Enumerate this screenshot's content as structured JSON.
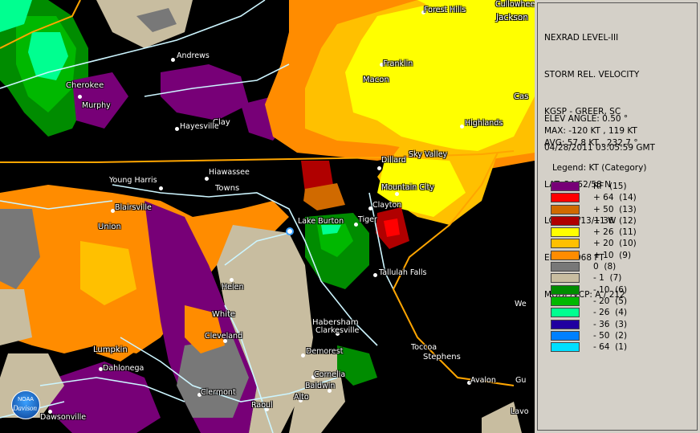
{
  "info": {
    "product": "NEXRAD LEVEL-III",
    "type": "STORM REL. VELOCITY",
    "site": "KGSP - GREER, SC",
    "datetime": "04/28/2011 03:05:59 GMT",
    "lat": "LAT: 34/52/58 N",
    "lon": "LON: 82/13/11 W",
    "elev": "ELEV: 1068 FT",
    "mode": "MODE/VCP: A / 212"
  },
  "stats": {
    "angle": "ELEV ANGLE: 0.50 °",
    "max": "MAX: -120 KT , 119 KT",
    "avg": "AVG: 57.8 KT , 232.7 °"
  },
  "legend": {
    "title": "Legend: KT (Category)",
    "items": [
      {
        "label": "RF  (15)",
        "color": "#770077"
      },
      {
        "label": "+ 64  (14)",
        "color": "#ff0000"
      },
      {
        "label": "+ 50  (13)",
        "color": "#d06a00"
      },
      {
        "label": "+ 36  (12)",
        "color": "#b00000"
      },
      {
        "label": "+ 26  (11)",
        "color": "#ffff00"
      },
      {
        "label": "+ 20  (10)",
        "color": "#ffc000"
      },
      {
        "label": "+ 10  (9)",
        "color": "#ff8c00"
      },
      {
        "label": "0  (8)",
        "color": "#787878"
      },
      {
        "label": "- 1  (7)",
        "color": "#c8bda0"
      },
      {
        "label": "- 10  (6)",
        "color": "#008c00"
      },
      {
        "label": "- 20  (5)",
        "color": "#00b800"
      },
      {
        "label": "- 26  (4)",
        "color": "#00ff90"
      },
      {
        "label": "- 36  (3)",
        "color": "#2000a0"
      },
      {
        "label": "- 50  (2)",
        "color": "#0080ff"
      },
      {
        "label": "- 64  (1)",
        "color": "#00e0ff"
      }
    ]
  },
  "map": {
    "labels": {
      "forest_hills": "Forest Hills",
      "cullowhee": "Cullowhee",
      "jackson": "Jackson",
      "andrews": "Andrews",
      "franklin": "Franklin",
      "cherokee": "Cherokee",
      "macon": "Macon",
      "cas": "Cas",
      "murphy": "Murphy",
      "clay": "Clay",
      "hayesville": "Hayesville",
      "highlands": "Highlands",
      "dillard": "Dillard",
      "sky_valley": "Sky Valley",
      "hiawassee": "Hiawassee",
      "young_harris": "Young Harris",
      "towns": "Towns",
      "mountain_city": "Mountain City",
      "clayton": "Clayton",
      "blairsville": "Blairsville",
      "lake_burton": "Lake Burton",
      "tiger": "Tiger",
      "union": "Union",
      "tallulah_falls": "Tallulah Falls",
      "helen": "Helen",
      "white": "White",
      "we": "We",
      "habersham": "Habersham",
      "clarkesville": "Clarkesville",
      "cleveland": "Cleveland",
      "lumpkin": "Lumpkin",
      "toccoa": "Toccoa",
      "stephens": "Stephens",
      "demorest": "Demorest",
      "dahlonega": "Dahlonega",
      "cornelia": "Cornelia",
      "avalon": "Avalon",
      "gu": "Gu",
      "baldwin": "Baldwin",
      "clermont": "Clermont",
      "alto": "Alto",
      "raoul": "Raoul",
      "lavo": "Lavo",
      "dawsonville": "Dawsonville",
      "noaa": "NOAA",
      "davison": "Davison"
    }
  }
}
